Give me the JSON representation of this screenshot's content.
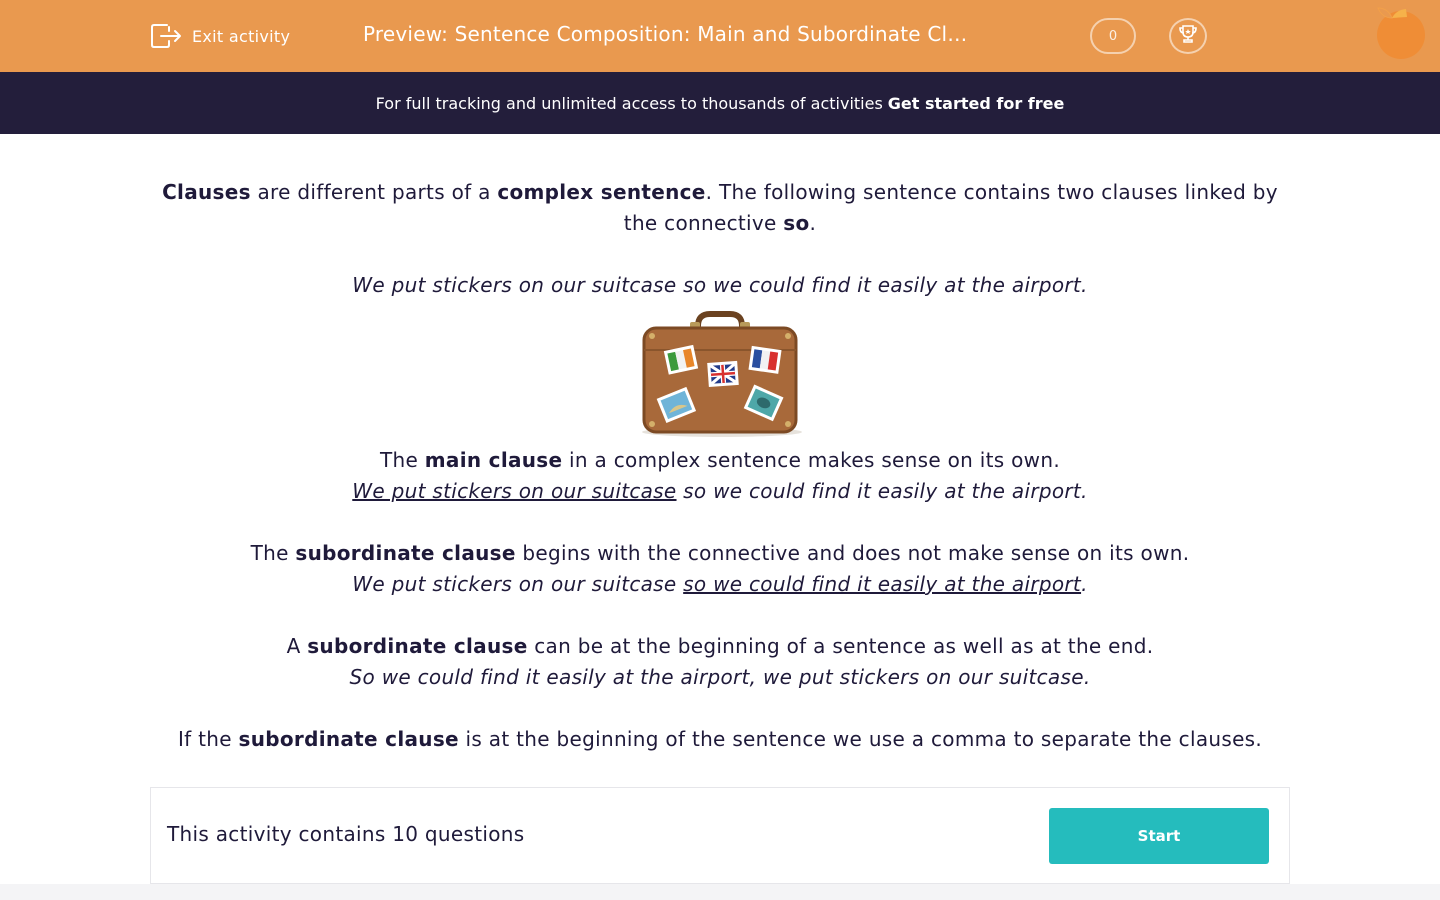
{
  "header": {
    "exit_label": "Exit activity",
    "title": "Preview: Sentence Composition: Main and Subordinate Cl…",
    "score": "0",
    "bg_color": "#e9994f"
  },
  "promo": {
    "text": "For full tracking and unlimited access to thousands of activities",
    "cta": "Get started for free",
    "bg_color": "#231e3b"
  },
  "content": {
    "intro": {
      "w1": "Clauses",
      "t1": " are different parts of a ",
      "w2": "complex sentence",
      "t2": ". The following sentence contains two clauses linked by the connective ",
      "w3": "so",
      "t3": "."
    },
    "example": "We put stickers on our suitcase so we could find it easily at the airport.",
    "main_clause": {
      "t1": "The ",
      "bold": "main clause",
      "t2": " in a complex sentence makes sense on its own.",
      "ex_underlined": "We put stickers on our suitcase",
      "ex_rest": " so we could find it easily at the airport."
    },
    "subordinate_clause": {
      "t1": "The ",
      "bold": "subordinate clause",
      "t2": " begins with the connective and does not make sense on its own.",
      "ex_start": "We put stickers on our suitcase ",
      "ex_underlined": "so we could find it easily at the airport",
      "ex_end": "."
    },
    "position": {
      "t1": "A ",
      "bold": "subordinate clause",
      "t2": " can be at the beginning of a sentence as well as at the end.",
      "example": "So we could find it easily at the airport, we put stickers on our suitcase."
    },
    "comma_rule": {
      "t1": "If the ",
      "bold": "subordinate clause",
      "t2": " is at the beginning of the sentence we use a comma to separate the clauses."
    }
  },
  "activity": {
    "count_text": "This activity contains 10 questions",
    "start_label": "Start",
    "button_color": "#25bcbd"
  },
  "icons": [
    "exit-icon",
    "trophy-icon",
    "orange-logo",
    "suitcase-image"
  ]
}
